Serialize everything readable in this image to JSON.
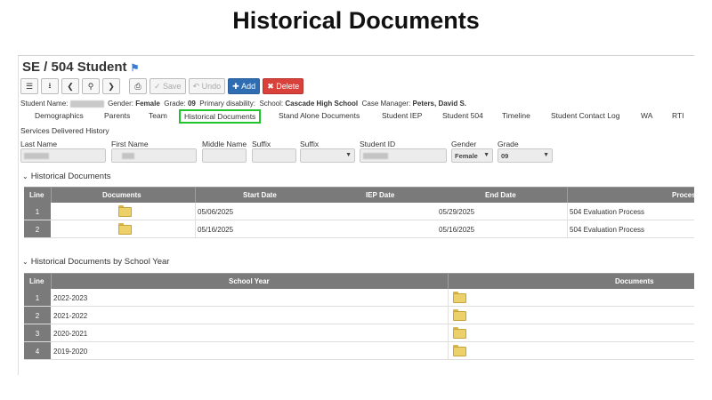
{
  "slide_title": "Historical Documents",
  "page": {
    "breadcrumb": "SE / 504 Student",
    "bookmark_icon": "bookmark-icon"
  },
  "toolbar": {
    "save_label": "Save",
    "undo_label": "Undo",
    "add_label": "Add",
    "delete_label": "Delete",
    "icons": [
      "list-icon",
      "student-icon",
      "prev-icon",
      "search-icon",
      "next-icon",
      "print-icon"
    ],
    "colors": {
      "add": "#2f6db3",
      "delete": "#d9423b"
    }
  },
  "student_info": {
    "name_label": "Student Name:",
    "gender_label": "Gender:",
    "gender": "Female",
    "grade_label": "Grade:",
    "grade": "09",
    "disability_label": "Primary disability:",
    "school_label": "School:",
    "school": "Cascade High School",
    "case_manager_label": "Case Manager:",
    "case_manager": "Peters, David S."
  },
  "tabs": [
    "Demographics",
    "Parents",
    "Team",
    "Historical Documents",
    "Stand Alone Documents",
    "Student IEP",
    "Student 504",
    "Timeline",
    "Student Contact Log",
    "WA",
    "RTI"
  ],
  "active_tab": "Historical Documents",
  "active_tab_color": "#22c42e",
  "tabs_row2": "Services Delivered History",
  "fields": {
    "last_name_label": "Last Name",
    "first_name_label": "First Name",
    "middle_name_label": "Middle Name",
    "suffix_label": "Suffix",
    "suffix2_label": "Suffix",
    "student_id_label": "Student ID",
    "gender_label": "Gender",
    "gender_value": "Female",
    "grade_label": "Grade",
    "grade_value": "09"
  },
  "historical_documents": {
    "title": "Historical Documents",
    "columns": [
      "Line",
      "Documents",
      "Start Date",
      "IEP Date",
      "End Date",
      "Proces"
    ],
    "rows": [
      {
        "line": "1",
        "start": "05/06/2025",
        "end": "05/29/2025",
        "process": "504 Evaluation Process"
      },
      {
        "line": "2",
        "start": "05/16/2025",
        "end": "05/16/2025",
        "process": "504 Evaluation Process"
      }
    ]
  },
  "by_school_year": {
    "title": "Historical Documents by School Year",
    "columns": [
      "Line",
      "School Year",
      "Documents"
    ],
    "rows": [
      {
        "line": "1",
        "year": "2022-2023"
      },
      {
        "line": "2",
        "year": "2021-2022"
      },
      {
        "line": "3",
        "year": "2020-2021"
      },
      {
        "line": "4",
        "year": "2019-2020"
      }
    ]
  }
}
